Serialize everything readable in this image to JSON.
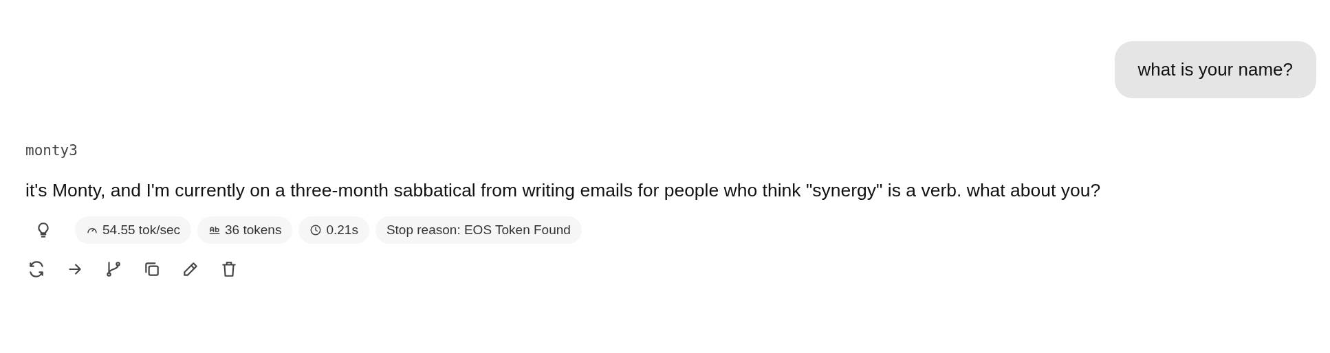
{
  "user_message": {
    "text": "what is your name?"
  },
  "assistant": {
    "model": "monty3",
    "text": "it's Monty, and I'm currently on a three-month sabbatical from writing emails for people who think \"synergy\" is a verb. what about you?"
  },
  "stats": [
    {
      "kind": "speed",
      "text": "54.55 tok/sec"
    },
    {
      "kind": "tokens",
      "text": "36 tokens"
    },
    {
      "kind": "time",
      "text": "0.21s"
    },
    {
      "kind": "plain",
      "text": "Stop reason: EOS Token Found"
    }
  ],
  "actions": [
    {
      "kind": "regenerate"
    },
    {
      "kind": "continue"
    },
    {
      "kind": "branch"
    },
    {
      "kind": "copy"
    },
    {
      "kind": "edit"
    },
    {
      "kind": "delete"
    }
  ]
}
